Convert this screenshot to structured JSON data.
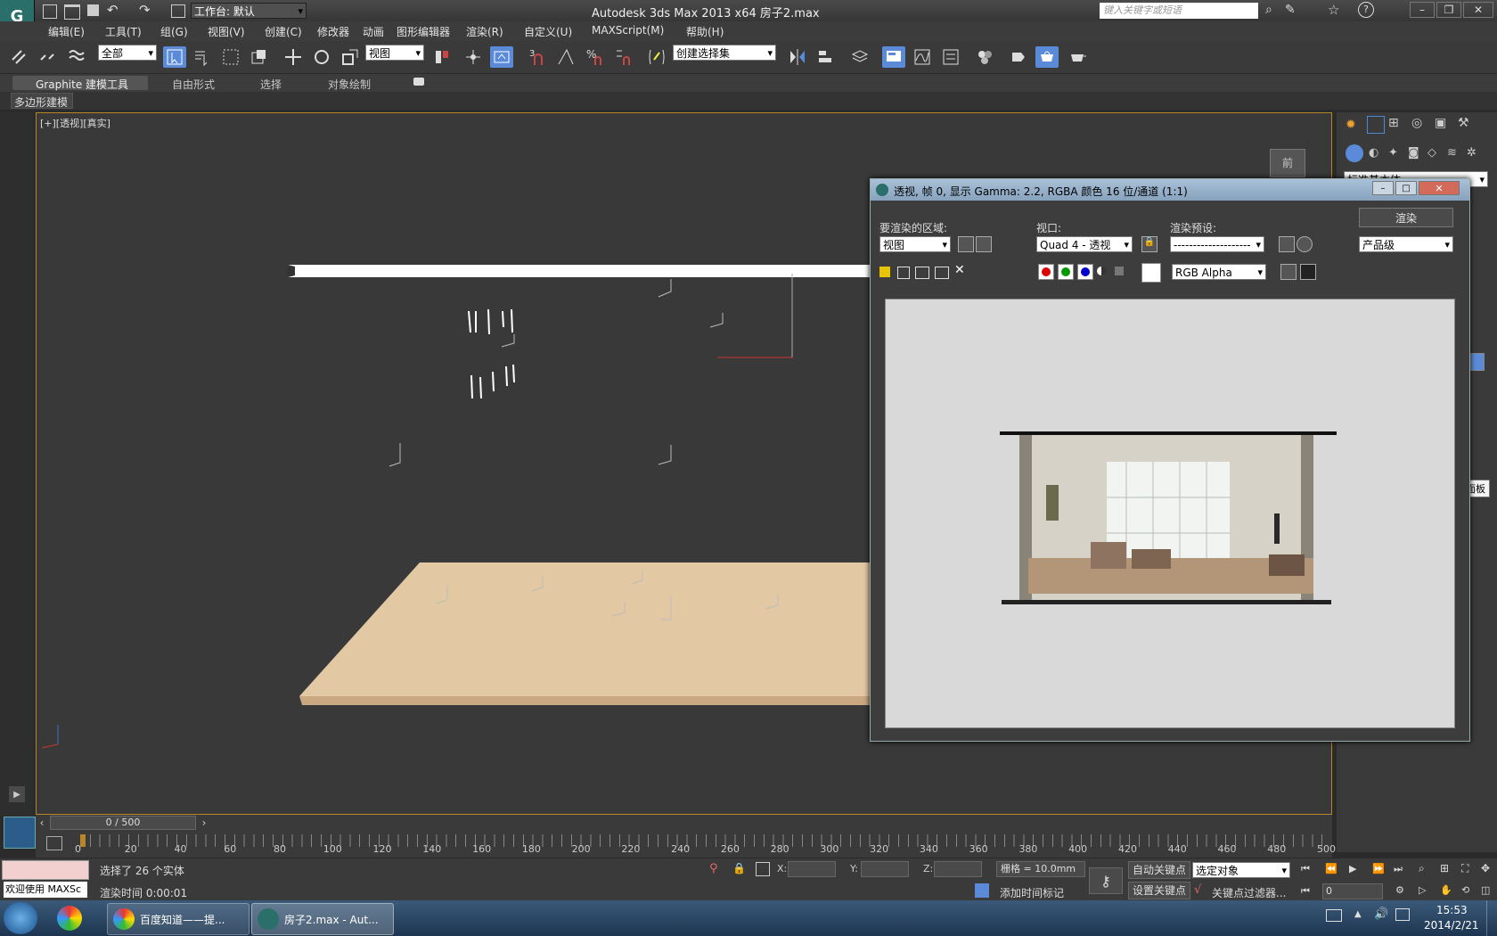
{
  "app": {
    "title": "Autodesk 3ds Max  2013 x64    房子2.max",
    "workspace": "工作台: 默认",
    "search_placeholder": "键入关键字或短语"
  },
  "menu": [
    "编辑(E)",
    "工具(T)",
    "组(G)",
    "视图(V)",
    "创建(C)",
    "修改器",
    "动画",
    "图形编辑器",
    "渲染(R)",
    "自定义(U)",
    "MAXScript(M)",
    "帮助(H)"
  ],
  "toolbar": {
    "selection_filter": "全部",
    "ref_coord": "视图",
    "snap_label": "3",
    "named_selection": "创建选择集"
  },
  "ribbon": {
    "tabs": [
      "Graphite 建模工具",
      "自由形式",
      "选择",
      "对象绘制"
    ],
    "sub": "多边形建模"
  },
  "viewport": {
    "label": "[+][透视][真实]",
    "viewcube": "前"
  },
  "render_window": {
    "title": "透视, 帧 0, 显示 Gamma: 2.2, RGBA 颜色 16 位/通道 (1:1)",
    "area_label": "要渲染的区域:",
    "area_value": "视图",
    "viewport_label": "视口:",
    "viewport_value": "Quad 4 - 透视",
    "preset_label": "渲染预设:",
    "preset_value": "--------------------",
    "render_button": "渲染",
    "quality_value": "产品级",
    "channel_value": "RGB Alpha"
  },
  "command_panel_tooltip": "命令面板",
  "command_panel_dropdown": "标准基本体",
  "timeline": {
    "frame": "0 / 500",
    "ticks": [
      "0",
      "20",
      "40",
      "60",
      "80",
      "100",
      "120",
      "140",
      "160",
      "180",
      "200",
      "220",
      "240",
      "260",
      "280",
      "300",
      "320",
      "340",
      "360",
      "380",
      "400",
      "420",
      "440",
      "460",
      "480",
      "500"
    ]
  },
  "status": {
    "welcome": "欢迎使用 MAXSc",
    "selection": "选择了 26 个实体",
    "render_time": "渲染时间  0:00:01",
    "x_label": "X:",
    "y_label": "Y:",
    "z_label": "Z:",
    "grid": "栅格 = 10.0mm",
    "add_time_tag": "添加时间标记",
    "auto_key": "自动关键点",
    "set_key": "设置关键点",
    "selected_object": "选定对象",
    "key_filter": "关键点过滤器...",
    "frame_value": "0"
  },
  "taskbar": {
    "items": [
      "百度知道——提...",
      "房子2.max - Aut..."
    ],
    "time": "15:53",
    "date": "2014/2/21"
  },
  "colors": {
    "accent": "#5b8bd8",
    "viewport_border": "#b7862a",
    "floor": "#e3c8a4"
  }
}
